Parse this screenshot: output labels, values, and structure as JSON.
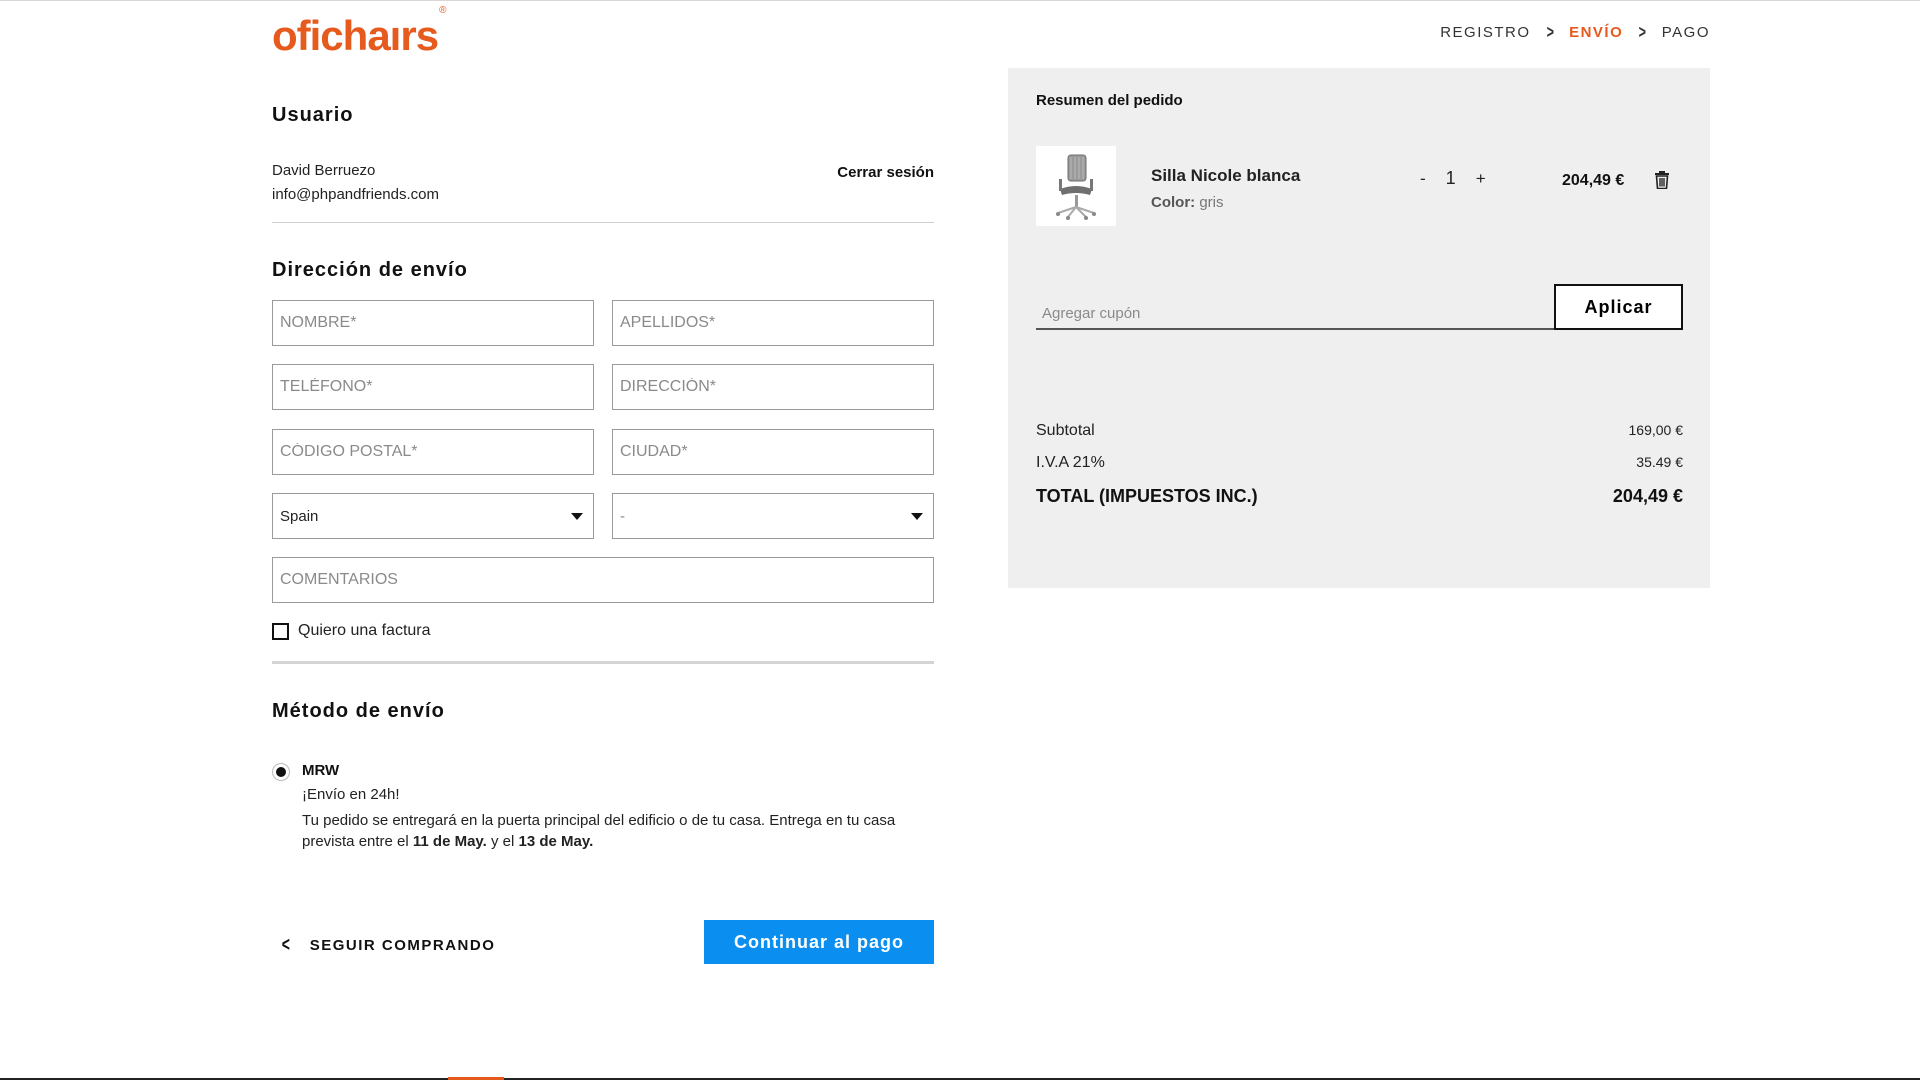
{
  "header": {
    "logo_text": "ofichaırs",
    "logo_mark": "®",
    "steps": [
      {
        "label": "REGISTRO",
        "active": false
      },
      {
        "label": "ENVÍO",
        "active": true
      },
      {
        "label": "PAGO",
        "active": false
      }
    ],
    "accent_color": "#e65a1d"
  },
  "user": {
    "title": "Usuario",
    "name": "David Berruezo",
    "email": "info@phpandfriends.com",
    "logout_label": "Cerrar sesión"
  },
  "shipping_address": {
    "title": "Dirección de envío",
    "fields": {
      "nombre": {
        "placeholder": "NOMBRE*",
        "value": ""
      },
      "apellidos": {
        "placeholder": "APELLIDOS*",
        "value": ""
      },
      "telefono": {
        "placeholder": "TELÉFONO*",
        "value": ""
      },
      "direccion": {
        "placeholder": "DIRECCIÓN*",
        "value": ""
      },
      "codigo_postal": {
        "placeholder": "CÓDIGO POSTAL*",
        "value": ""
      },
      "ciudad": {
        "placeholder": "CIUDAD*",
        "value": ""
      },
      "comentarios": {
        "placeholder": "COMENTARIOS",
        "value": ""
      }
    },
    "country_select": "Spain",
    "province_select": "-",
    "invoice_checkbox_label": "Quiero una factura",
    "invoice_checked": false
  },
  "shipping_method": {
    "title": "Método de envío",
    "option": {
      "name": "MRW",
      "tagline": "¡Envío en 24h!",
      "desc_part1": "Tu pedido se entregará en la puerta principal del edificio o de tu casa. Entrega en tu casa prevista entre el ",
      "date_from": "11 de May.",
      "desc_part2": " y el ",
      "date_to": "13 de May.",
      "selected": true
    }
  },
  "actions": {
    "back_label": "SEGUIR COMPRANDO",
    "continue_label": "Continuar al pago",
    "continue_color": "#0a8ef0"
  },
  "summary": {
    "title": "Resumen del pedido",
    "item": {
      "name": "Silla Nicole blanca",
      "color_label": "Color:",
      "color_value": "gris",
      "qty_minus": "-",
      "quantity": "1",
      "qty_plus": "+",
      "price": "204,49 €",
      "image_icon": "office-chair-icon",
      "delete_icon": "trash-icon"
    },
    "coupon_placeholder": "Agregar cupón",
    "apply_label": "Aplicar",
    "subtotal_label": "Subtotal",
    "subtotal_value": "169,00 €",
    "tax_label": "I.V.A 21%",
    "tax_value": "35.49 €",
    "total_label": "TOTAL (IMPUESTOS INC.)",
    "total_value": "204,49 €",
    "panel_color": "#efefef"
  }
}
